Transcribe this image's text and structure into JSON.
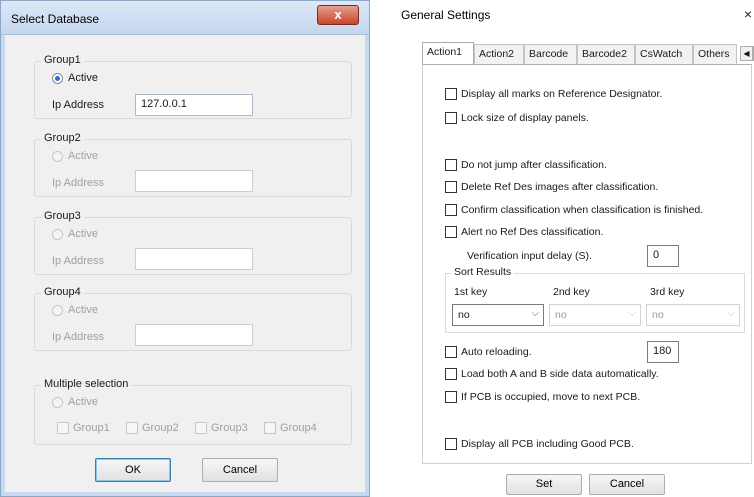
{
  "select_database": {
    "title": "Select Database",
    "close_glyph": "x",
    "groups": [
      {
        "name": "Group1",
        "active_label": "Active",
        "ip_label": "Ip Address",
        "ip_value": "127.0.0.1",
        "active_checked": true,
        "enabled": true
      },
      {
        "name": "Group2",
        "active_label": "Active",
        "ip_label": "Ip Address",
        "ip_value": "",
        "active_checked": false,
        "enabled": false
      },
      {
        "name": "Group3",
        "active_label": "Active",
        "ip_label": "Ip Address",
        "ip_value": "",
        "active_checked": false,
        "enabled": false
      },
      {
        "name": "Group4",
        "active_label": "Active",
        "ip_label": "Ip Address",
        "ip_value": "",
        "active_checked": false,
        "enabled": false
      }
    ],
    "multiple_selection": {
      "title": "Multiple selection",
      "active_label": "Active",
      "checkboxes": [
        "Group1",
        "Group2",
        "Group3",
        "Group4"
      ]
    },
    "ok_label": "OK",
    "cancel_label": "Cancel"
  },
  "general_settings": {
    "title": "General Settings",
    "close_glyph": "×",
    "tabs": [
      "Action1",
      "Action2",
      "Barcode",
      "Barcode2",
      "CsWatch",
      "Others"
    ],
    "active_tab": "Action1",
    "tab_scroll": {
      "left": "◀",
      "right": "▶"
    },
    "options": {
      "display_all_marks": "Display all marks on Reference Designator.",
      "lock_size": "Lock size of display panels.",
      "do_not_jump": "Do not jump after classification.",
      "delete_ref_des": "Delete Ref Des images after classification.",
      "confirm_classification": "Confirm classification when classification is finished.",
      "alert_no_ref_des": "Alert no Ref Des classification.",
      "verification_delay_label": "Verification input delay (S).",
      "verification_delay_value": "0",
      "auto_reloading": "Auto reloading.",
      "auto_reloading_value": "180",
      "load_both": "Load both A and B side data automatically.",
      "if_pcb_occupied": "If PCB is occupied, move to next PCB.",
      "display_all_pcb": "Display all PCB including Good PCB."
    },
    "sort_results": {
      "title": "Sort Results",
      "keys": [
        {
          "label": "1st key",
          "value": "no",
          "enabled": true
        },
        {
          "label": "2nd key",
          "value": "no",
          "enabled": false
        },
        {
          "label": "3rd key",
          "value": "no",
          "enabled": false
        }
      ]
    },
    "set_label": "Set",
    "cancel_label": "Cancel"
  }
}
